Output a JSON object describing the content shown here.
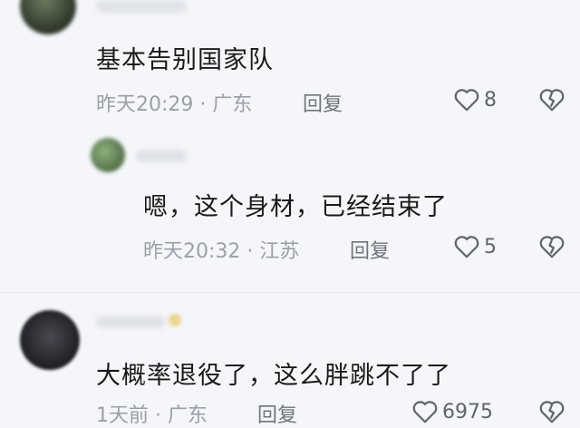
{
  "comments": [
    {
      "text": "基本告别国家队",
      "time": "昨天20:29",
      "separator": "·",
      "location": "广东",
      "reply_label": "回复",
      "likes": "8"
    },
    {
      "text": "嗯，这个身材，已经结束了",
      "time": "昨天20:32",
      "separator": "·",
      "location": "江苏",
      "reply_label": "回复",
      "likes": "5"
    },
    {
      "text": "大概率退役了，这么胖跳不了了",
      "time": "1天前",
      "separator": "·",
      "location": "广东",
      "reply_label": "回复",
      "likes": "6975"
    }
  ],
  "icons": {
    "like": "heart-outline-icon",
    "dislike": "broken-heart-icon"
  },
  "colors": {
    "background": "#f4f6f9",
    "text": "#1a1a1a",
    "meta": "#9aa0a8",
    "icon": "#5f656d"
  }
}
